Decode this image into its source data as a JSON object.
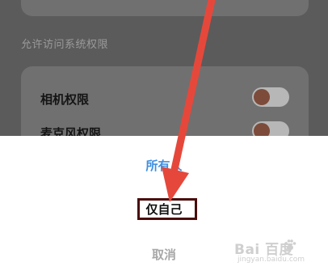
{
  "background": {
    "section_title": "允许访问系统权限",
    "permissions": [
      {
        "label": "相机权限"
      },
      {
        "label": "麦克风权限"
      }
    ]
  },
  "sheet": {
    "options": [
      {
        "label": "所有人",
        "color": "#3d8fe3"
      },
      {
        "label": "仅自己"
      },
      {
        "label": "取消"
      }
    ]
  },
  "annotation": {
    "highlight_color": "#4a0c0c",
    "arrow_color": "#e5483b"
  },
  "watermark": {
    "logo_text": "Bai 百度",
    "sub_text": "jingyan.baidu.com"
  }
}
